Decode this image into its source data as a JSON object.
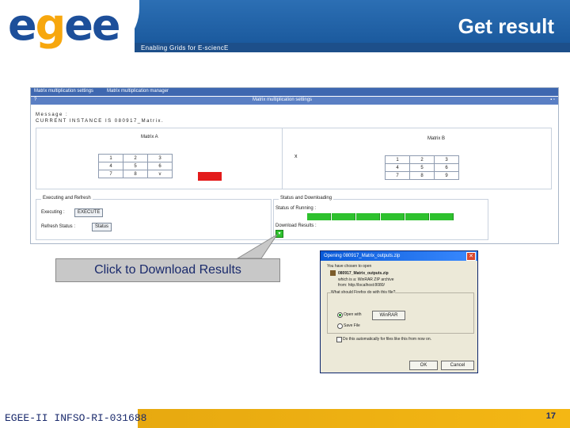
{
  "header": {
    "logo": "egee",
    "tagline": "Enabling Grids for E-sciencE",
    "title": "Get result"
  },
  "app": {
    "tabs": [
      "Matrix multiplication settings",
      "Matrix multiplication manager"
    ],
    "window_title": "Matrix multiplication settings",
    "help_glyph": "?",
    "message_label": "Message :",
    "message_text": "CURRENT INSTANCE IS 080917_Matrix.",
    "matrix_a_label": "Matrix A",
    "matrix_b_label": "Matrix B",
    "times_symbol": "x",
    "matrix_a": [
      [
        "1",
        "2",
        "3"
      ],
      [
        "4",
        "5",
        "6"
      ],
      [
        "7",
        "8",
        "v"
      ]
    ],
    "matrix_b": [
      [
        "1",
        "2",
        "3"
      ],
      [
        "4",
        "5",
        "6"
      ],
      [
        "7",
        "8",
        "9"
      ]
    ],
    "executing_group": "Executing and Refresh",
    "executing_label": "Executing :",
    "execute_button": "EXECUTE",
    "refresh_label": "Refresh Status :",
    "status_button": "Status",
    "status_group": "Status and Downloading",
    "status_running_label": "Status of Running :",
    "progress_segments": 6,
    "download_label": "Download Results :"
  },
  "callout": {
    "text": "Click to Download Results"
  },
  "dialog": {
    "title": "Opening 080917_Matrix_outputs.zip",
    "intro": "You have chosen to open",
    "filename": "080917_Matrix_outputs.zip",
    "which_is": "which is a: WinRAR ZIP archive",
    "from": "from: http://localhost:8080/",
    "question": "What should Firefox do with this file?",
    "open_with_label": "Open with",
    "open_with_value": "WinRAR",
    "save_label": "Save File",
    "auto_label": "Do this automatically for files like this from now on.",
    "ok": "OK",
    "cancel": "Cancel"
  },
  "footer": {
    "left": "EGEE-II INFSO-RI-031688",
    "page": "17"
  },
  "colors": {
    "header_blue": "#1b5a9e",
    "footer_gold": "#f4b714",
    "status_green": "#2ec12e",
    "alert_red": "#e31b1b"
  }
}
